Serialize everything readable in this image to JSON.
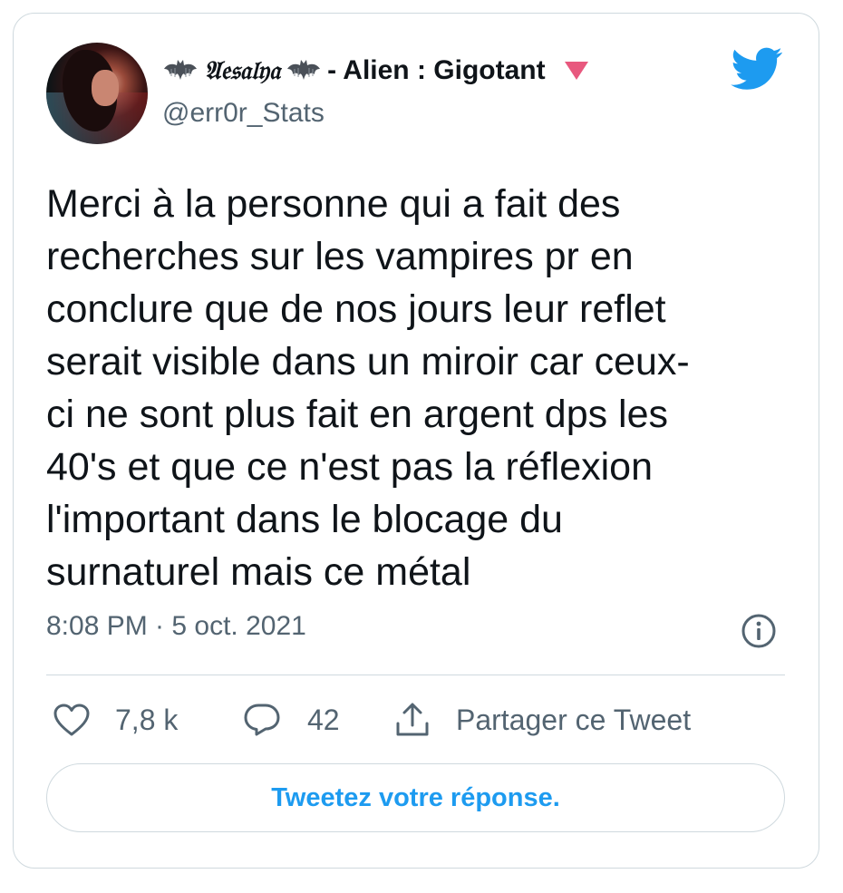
{
  "author": {
    "display_name_fancy": "𝔄𝔢𝔰𝔞𝔩𝔶𝔞",
    "display_name_rest": "- Alien : Gigotant",
    "handle": "@err0r_Stats",
    "avatar_icon": "avatar-photo",
    "name_decoration_icons": [
      "bat-icon",
      "bat-icon",
      "pink-triangle-icon"
    ]
  },
  "brand": {
    "icon": "twitter-bird-icon",
    "color": "#1d9bf0"
  },
  "tweet": {
    "text": "Merci à la personne qui a fait des\nrecherches sur les vampires pr en\nconclure que de nos jours leur reflet\nserait visible dans un miroir car ceux-\nci ne sont plus fait en argent dps les\n40's et que ce n'est pas la réflexion\nl'important dans le blocage du\nsurnaturel mais ce métal",
    "timestamp": "8:08 PM · 5 oct. 2021"
  },
  "actions": {
    "like_count": "7,8 k",
    "reply_count": "42",
    "share_label": "Partager ce Tweet"
  },
  "reply_prompt": "Tweetez votre réponse.",
  "colors": {
    "text": "#0f1419",
    "secondary": "#536471",
    "border": "#cfd9de",
    "triangle": "#e8587e"
  }
}
